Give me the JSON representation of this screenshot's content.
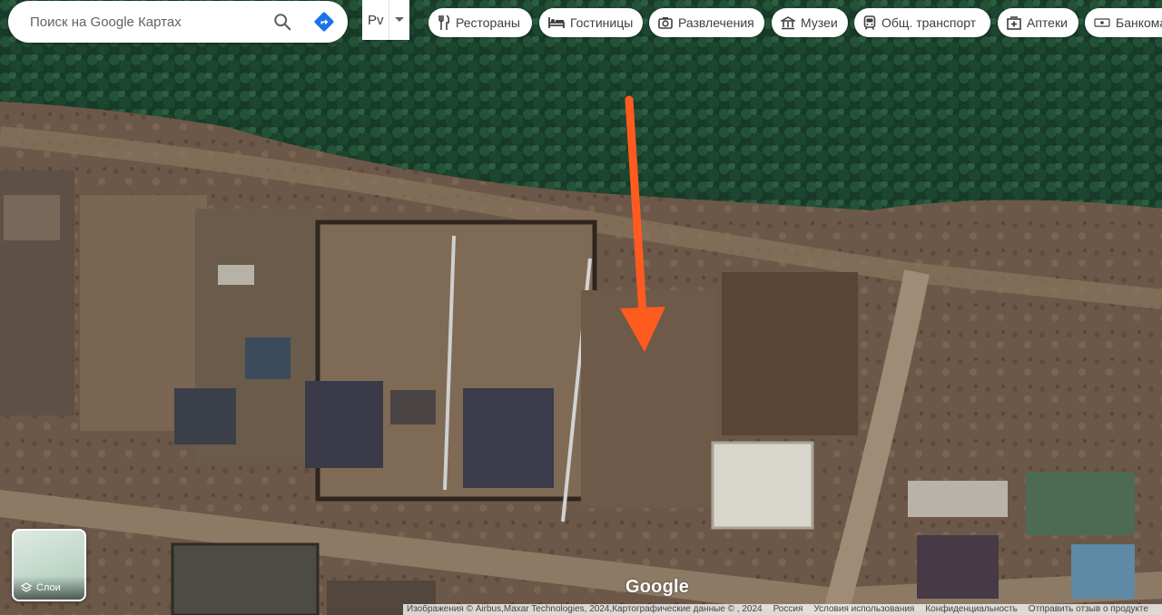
{
  "search": {
    "placeholder": "Поиск на Google Картах"
  },
  "language_toggle": {
    "label": "Рv"
  },
  "categories": [
    {
      "label": "Рестораны",
      "icon": "restaurant-icon"
    },
    {
      "label": "Гостиницы",
      "icon": "hotel-icon"
    },
    {
      "label": "Развлечения",
      "icon": "camera-icon"
    },
    {
      "label": "Музеи",
      "icon": "museum-icon"
    },
    {
      "label": "Общ. транспорт",
      "icon": "transit-icon"
    },
    {
      "label": "Аптеки",
      "icon": "pharmacy-icon"
    },
    {
      "label": "Банкоматы",
      "icon": "atm-icon"
    }
  ],
  "layers_button": {
    "label": "Слои"
  },
  "logo": "Google",
  "footer": {
    "attribution": "Изображения © Airbus,Maxar Technologies, 2024,Картографические данные © , 2024",
    "links": [
      "Россия",
      "Условия использования",
      "Конфиденциальность",
      "Отправить отзыв о продукте"
    ]
  },
  "annotation": {
    "arrow_color": "#ff5a1f"
  }
}
